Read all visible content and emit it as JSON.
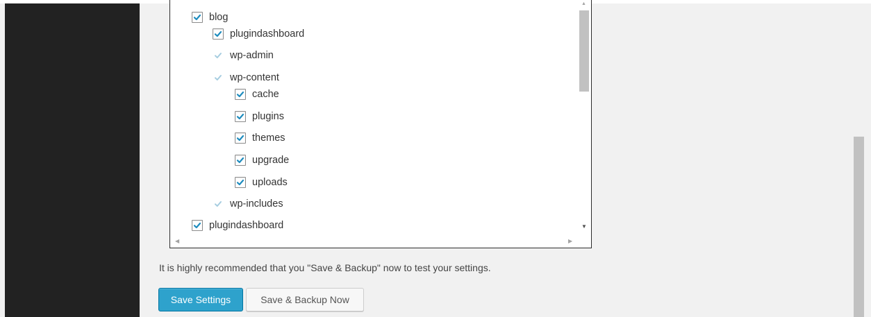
{
  "tree": {
    "items": [
      {
        "label": "blog",
        "state": "checked"
      },
      {
        "label": "plugindashboard",
        "state": "checked"
      },
      {
        "label": "wp-admin",
        "state": "partial"
      },
      {
        "label": "wp-content",
        "state": "partial"
      },
      {
        "label": "cache",
        "state": "checked"
      },
      {
        "label": "plugins",
        "state": "checked"
      },
      {
        "label": "themes",
        "state": "checked"
      },
      {
        "label": "upgrade",
        "state": "checked"
      },
      {
        "label": "uploads",
        "state": "checked"
      },
      {
        "label": "wp-includes",
        "state": "partial"
      },
      {
        "label": "plugindashboard",
        "state": "checked"
      }
    ]
  },
  "recommendation": "It is highly recommended that you \"Save & Backup\" now to test your settings.",
  "buttons": {
    "save_settings": "Save Settings",
    "save_backup_now": "Save & Backup Now"
  },
  "colors": {
    "primary_button": "#2ea2cc",
    "check_dark": "#1e8cbe",
    "check_light": "#a6cde0",
    "sidebar": "#222222"
  },
  "icons": {
    "checkbox_checked": "checkmark-icon",
    "checkbox_partial": "checkmark-light-icon"
  }
}
